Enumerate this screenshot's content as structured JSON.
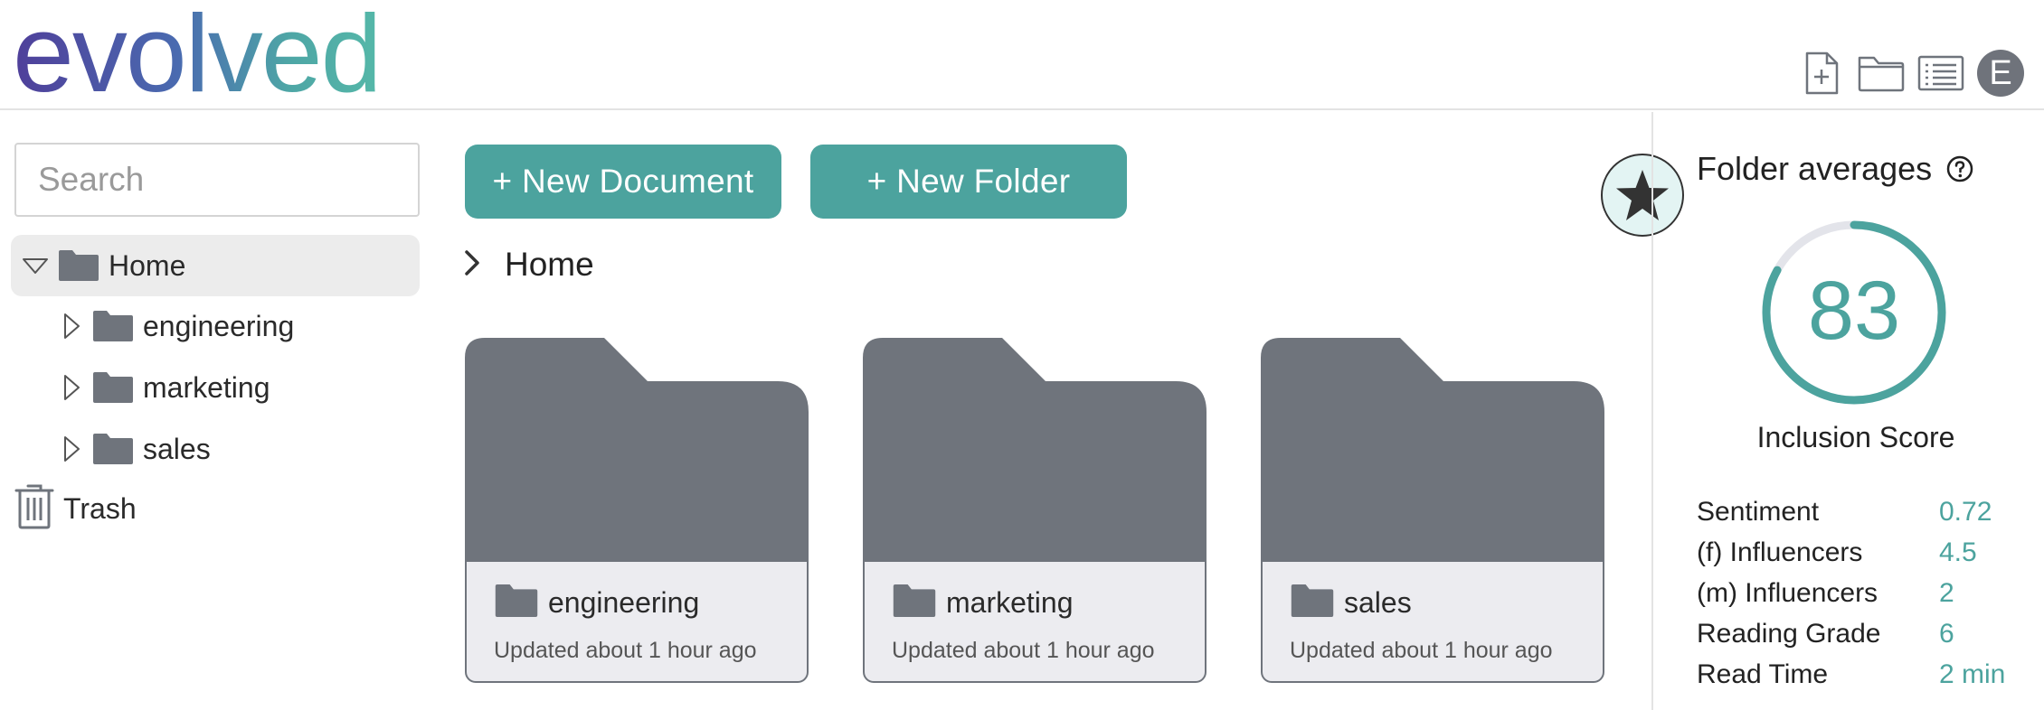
{
  "brand": {
    "logo_text": "evolved",
    "colors": {
      "accent": "#4ca39e",
      "folder": "#6f747c",
      "gradient_start": "#4f3f9a",
      "gradient_end": "#55b8a8"
    }
  },
  "header": {
    "icons": [
      "new-document-icon",
      "folder-icon",
      "list-view-icon"
    ],
    "avatar_initial": "E"
  },
  "sidebar": {
    "search": {
      "placeholder": "Search",
      "value": ""
    },
    "tree": {
      "root": {
        "label": "Home",
        "expanded": true,
        "selected": true
      },
      "children": [
        {
          "label": "engineering"
        },
        {
          "label": "marketing"
        },
        {
          "label": "sales"
        }
      ]
    },
    "trash_label": "Trash"
  },
  "main": {
    "buttons": {
      "new_document": "+ New Document",
      "new_folder": "+ New Folder"
    },
    "breadcrumb": {
      "current": "Home"
    },
    "folders": [
      {
        "name": "engineering",
        "updated": "Updated about 1 hour ago"
      },
      {
        "name": "marketing",
        "updated": "Updated about 1 hour ago"
      },
      {
        "name": "sales",
        "updated": "Updated about 1 hour ago"
      }
    ]
  },
  "right_panel": {
    "title": "Folder averages",
    "score": {
      "value": "83",
      "label": "Inclusion Score",
      "fill_fraction": 0.83
    },
    "stats": [
      {
        "label": "Sentiment",
        "value": "0.72"
      },
      {
        "label": "(f) Influencers",
        "value": "4.5"
      },
      {
        "label": "(m) Influencers",
        "value": "2"
      },
      {
        "label": "Reading Grade",
        "value": "6"
      },
      {
        "label": "Read Time",
        "value": "2 min"
      }
    ]
  }
}
